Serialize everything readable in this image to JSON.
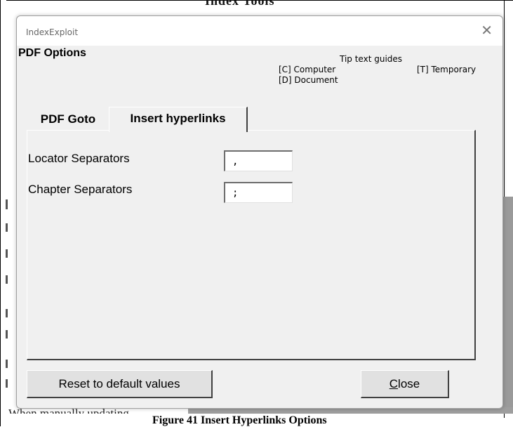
{
  "background": {
    "top_text": "Index Tools",
    "bottom_text": "When manually updating"
  },
  "dialog": {
    "title": "IndexExploit",
    "heading": "PDF Options",
    "tips": {
      "title": "Tip text guides",
      "computer": "[C] Computer",
      "document": "[D] Document",
      "temporary": "[T] Temporary"
    },
    "tabs": [
      {
        "label": "PDF Goto",
        "active": false
      },
      {
        "label": "Insert hyperlinks",
        "active": true
      }
    ],
    "fields": {
      "locator_label": "Locator Separators",
      "locator_value": ",",
      "chapter_label": "Chapter Separators",
      "chapter_value": ";"
    },
    "buttons": {
      "reset": "Reset to default values",
      "close": "Close"
    }
  },
  "caption": "Figure 41 Insert Hyperlinks Options",
  "icons": {
    "close": "close-icon"
  }
}
